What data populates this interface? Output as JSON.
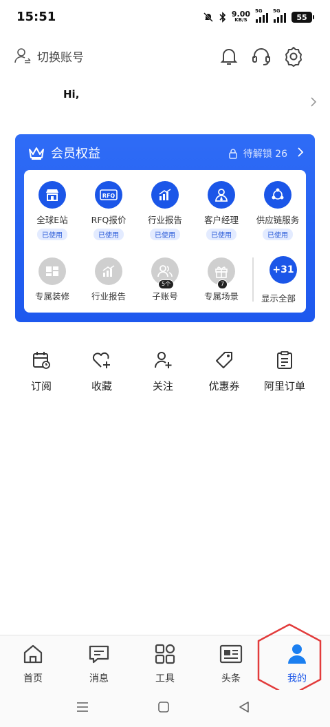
{
  "status_bar": {
    "time": "15:51",
    "net_speed": "9.00",
    "net_unit": "KB/S",
    "sim1": "5G",
    "sim2": "5G",
    "battery": "55"
  },
  "header": {
    "switch_account": "切换账号",
    "icons": [
      "bell-icon",
      "headset-icon",
      "gear-icon"
    ]
  },
  "greeting": "Hi,",
  "member_card": {
    "title": "会员权益",
    "unlock_text": "待解锁 26",
    "accent": "#1d58ee",
    "unlocked": [
      {
        "label": "全球E站",
        "tag": "已使用",
        "icon": "store-icon"
      },
      {
        "label": "RFQ报价",
        "tag": "已使用",
        "icon": "rfq-icon"
      },
      {
        "label": "行业报告",
        "tag": "已使用",
        "icon": "chart-icon"
      },
      {
        "label": "客户经理",
        "tag": "已使用",
        "icon": "manager-icon"
      },
      {
        "label": "供应链服务",
        "tag": "已使用",
        "icon": "supply-chain-icon"
      }
    ],
    "locked": [
      {
        "label": "专属装修",
        "icon": "layout-icon"
      },
      {
        "label": "行业报告",
        "icon": "chart-icon"
      },
      {
        "label": "子账号",
        "badge": "5个",
        "icon": "users-icon"
      },
      {
        "label": "专属场景",
        "badge": "7",
        "icon": "gift-icon"
      }
    ],
    "more": {
      "value": "+31",
      "label": "显示全部"
    }
  },
  "quick_actions": [
    {
      "label": "订阅",
      "icon": "calendar-icon"
    },
    {
      "label": "收藏",
      "icon": "heart-plus-icon"
    },
    {
      "label": "关注",
      "icon": "user-plus-icon"
    },
    {
      "label": "优惠券",
      "icon": "tag-icon"
    },
    {
      "label": "阿里订单",
      "icon": "clipboard-icon"
    }
  ],
  "tab_bar": [
    {
      "label": "首页",
      "icon": "home-icon"
    },
    {
      "label": "消息",
      "icon": "message-icon"
    },
    {
      "label": "工具",
      "icon": "grid-icon"
    },
    {
      "label": "头条",
      "icon": "news-icon"
    },
    {
      "label": "我的",
      "icon": "person-icon",
      "active": true
    }
  ],
  "highlight_color": "#e23b3b"
}
